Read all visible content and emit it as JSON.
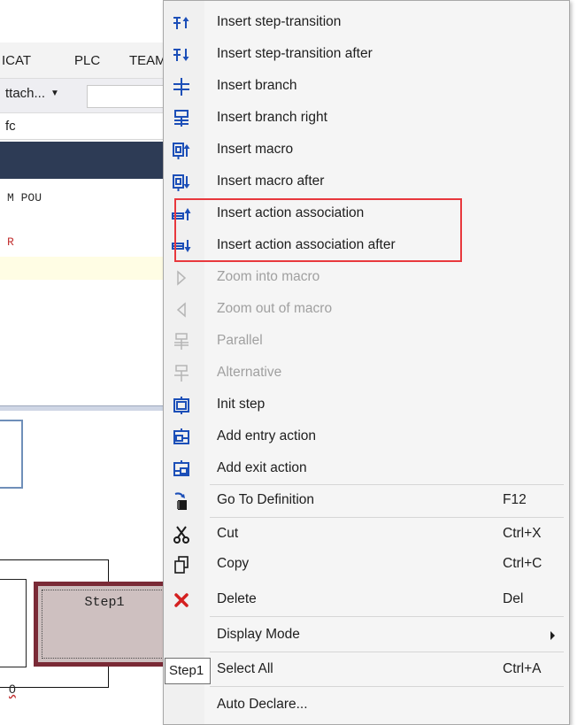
{
  "menubar": {
    "items": [
      "ICAT",
      "PLC",
      "TEAM"
    ]
  },
  "toolbar": {
    "attach_label": "ttach..."
  },
  "editor": {
    "file_path": "fc",
    "decl_line_1": "M POU",
    "decl_line_2": "R"
  },
  "sfc": {
    "step_label": "Step1",
    "bottom_text": "0"
  },
  "tooltip": {
    "text": "Step1"
  },
  "context_menu": {
    "items": [
      {
        "label": "Insert step-transition",
        "shortcut": "",
        "icon": "insert-step-transition-icon"
      },
      {
        "label": "Insert step-transition after",
        "shortcut": "",
        "icon": "insert-step-transition-after-icon"
      },
      {
        "label": "Insert branch",
        "shortcut": "",
        "icon": "insert-branch-icon"
      },
      {
        "label": "Insert branch right",
        "shortcut": "",
        "icon": "insert-branch-right-icon"
      },
      {
        "label": "Insert macro",
        "shortcut": "",
        "icon": "insert-macro-icon"
      },
      {
        "label": "Insert macro after",
        "shortcut": "",
        "icon": "insert-macro-after-icon"
      },
      {
        "label": "Insert action association",
        "shortcut": "",
        "icon": "insert-action-association-icon"
      },
      {
        "label": "Insert action association after",
        "shortcut": "",
        "icon": "insert-action-association-after-icon"
      },
      {
        "label": "Zoom into macro",
        "shortcut": "",
        "icon": "zoom-into-macro-icon",
        "disabled": true
      },
      {
        "label": "Zoom out of macro",
        "shortcut": "",
        "icon": "zoom-out-of-macro-icon",
        "disabled": true
      },
      {
        "label": "Parallel",
        "shortcut": "",
        "icon": "parallel-icon",
        "disabled": true
      },
      {
        "label": "Alternative",
        "shortcut": "",
        "icon": "alternative-icon",
        "disabled": true
      },
      {
        "label": "Init step",
        "shortcut": "",
        "icon": "init-step-icon"
      },
      {
        "label": "Add entry action",
        "shortcut": "",
        "icon": "add-entry-action-icon"
      },
      {
        "label": "Add exit action",
        "shortcut": "",
        "icon": "add-exit-action-icon"
      },
      {
        "label": "Go To Definition",
        "shortcut": "F12",
        "icon": "go-to-definition-icon"
      },
      {
        "label": "Cut",
        "shortcut": "Ctrl+X",
        "icon": "cut-icon"
      },
      {
        "label": "Copy",
        "shortcut": "Ctrl+C",
        "icon": "copy-icon"
      },
      {
        "label": "Delete",
        "shortcut": "Del",
        "icon": "delete-icon"
      },
      {
        "label": "Display Mode",
        "shortcut": "",
        "icon": "submenu-arrow-icon"
      },
      {
        "label": "Select All",
        "shortcut": "Ctrl+A",
        "icon": "select-all-icon"
      },
      {
        "label": "Auto Declare...",
        "shortcut": "",
        "icon": ""
      }
    ]
  },
  "colors": {
    "icon_blue": "#1c4fb8",
    "highlight_box": "#e8383d",
    "delete_red": "#d42020",
    "step_fill": "#cec0c0",
    "step_border": "#7a2a36"
  }
}
